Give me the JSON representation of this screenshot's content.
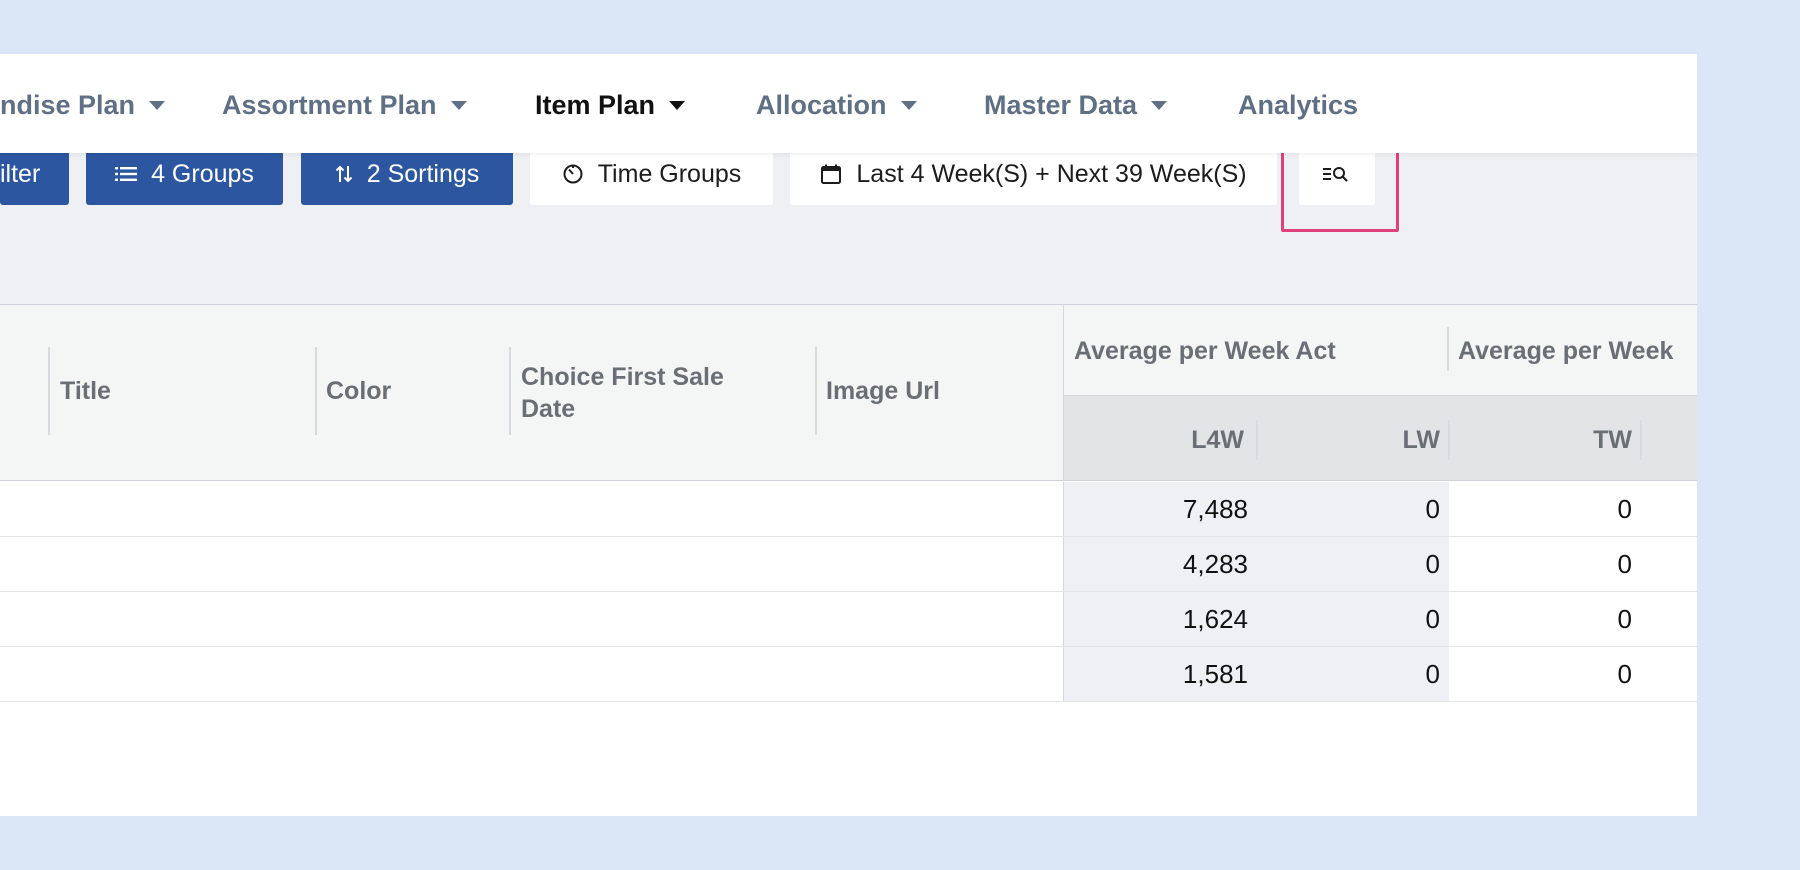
{
  "nav": {
    "items": [
      {
        "label": "ndise Plan",
        "active": false,
        "dropdown": true
      },
      {
        "label": "Assortment Plan",
        "active": false,
        "dropdown": true
      },
      {
        "label": "Item Plan",
        "active": true,
        "dropdown": true
      },
      {
        "label": "Allocation",
        "active": false,
        "dropdown": true
      },
      {
        "label": "Master Data",
        "active": false,
        "dropdown": true
      },
      {
        "label": "Analytics",
        "active": false,
        "dropdown": false
      }
    ]
  },
  "toolbar": {
    "filter_label": "ilter",
    "groups_label": "4 Groups",
    "sortings_label": "2 Sortings",
    "time_groups_label": "Time Groups",
    "date_range_label": "Last 4 Week(S) + Next 39 Week(S)",
    "search_columns_icon": "list-search-icon"
  },
  "grid": {
    "columns": [
      "Title",
      "Color",
      "Choice First Sale Date",
      "Image Url"
    ],
    "group_headers": [
      "Average per Week Act",
      "Average per Week"
    ],
    "sub_headers": [
      "L4W",
      "LW",
      "TW"
    ],
    "rows": [
      {
        "l4w": "7,488",
        "lw": "0",
        "tw": "0"
      },
      {
        "l4w": "4,283",
        "lw": "0",
        "tw": "0"
      },
      {
        "l4w": "1,624",
        "lw": "0",
        "tw": "0"
      },
      {
        "l4w": "1,581",
        "lw": "0",
        "tw": "0"
      }
    ]
  },
  "colors": {
    "primary_button": "#2c56a0",
    "highlight": "#e0407b",
    "background": "#dbe7f7"
  }
}
